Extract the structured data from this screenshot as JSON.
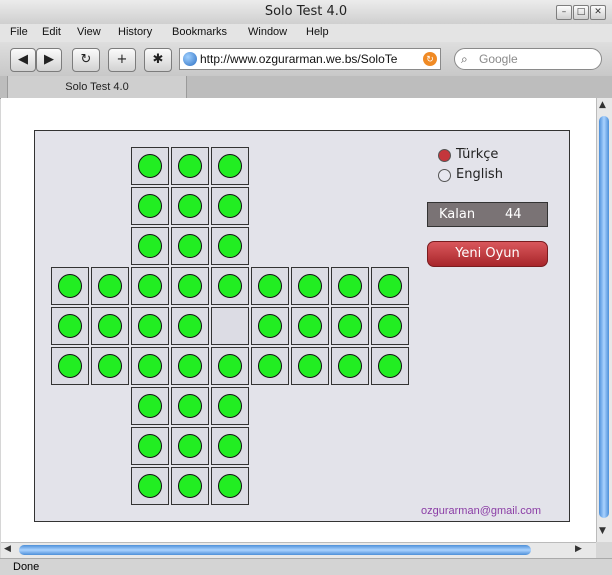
{
  "window": {
    "title": "Solo Test 4.0"
  },
  "menu": [
    "File",
    "Edit",
    "View",
    "History",
    "Bookmarks",
    "Window",
    "Help"
  ],
  "toolbar": {
    "back": "◀",
    "forward": "▶",
    "reload": "↻",
    "add": "+",
    "bug": "✱",
    "url": "http://www.ozgurarman.we.bs/SoloTe",
    "search_placeholder": "Google",
    "search_icon": "⌕"
  },
  "tab": {
    "label": "Solo Test 4.0"
  },
  "status": {
    "text": "Done"
  },
  "game": {
    "languages": [
      {
        "label": "Türkçe",
        "selected": true
      },
      {
        "label": "English",
        "selected": false
      }
    ],
    "counter_label": "Kalan",
    "counter_value": "44",
    "new_game_label": "Yeni Oyun",
    "email": "ozgurarman@gmail.com",
    "board": [
      "..###...",
      "..###...",
      "..###...",
      "#########",
      "####.####",
      "#########",
      "..###...",
      "..###...",
      "..###..."
    ],
    "colors": {
      "peg": "#22ee22",
      "cell": "#dcdce4",
      "board_bg": "#e3e3ea",
      "selected_radio": "#c4363c"
    }
  }
}
